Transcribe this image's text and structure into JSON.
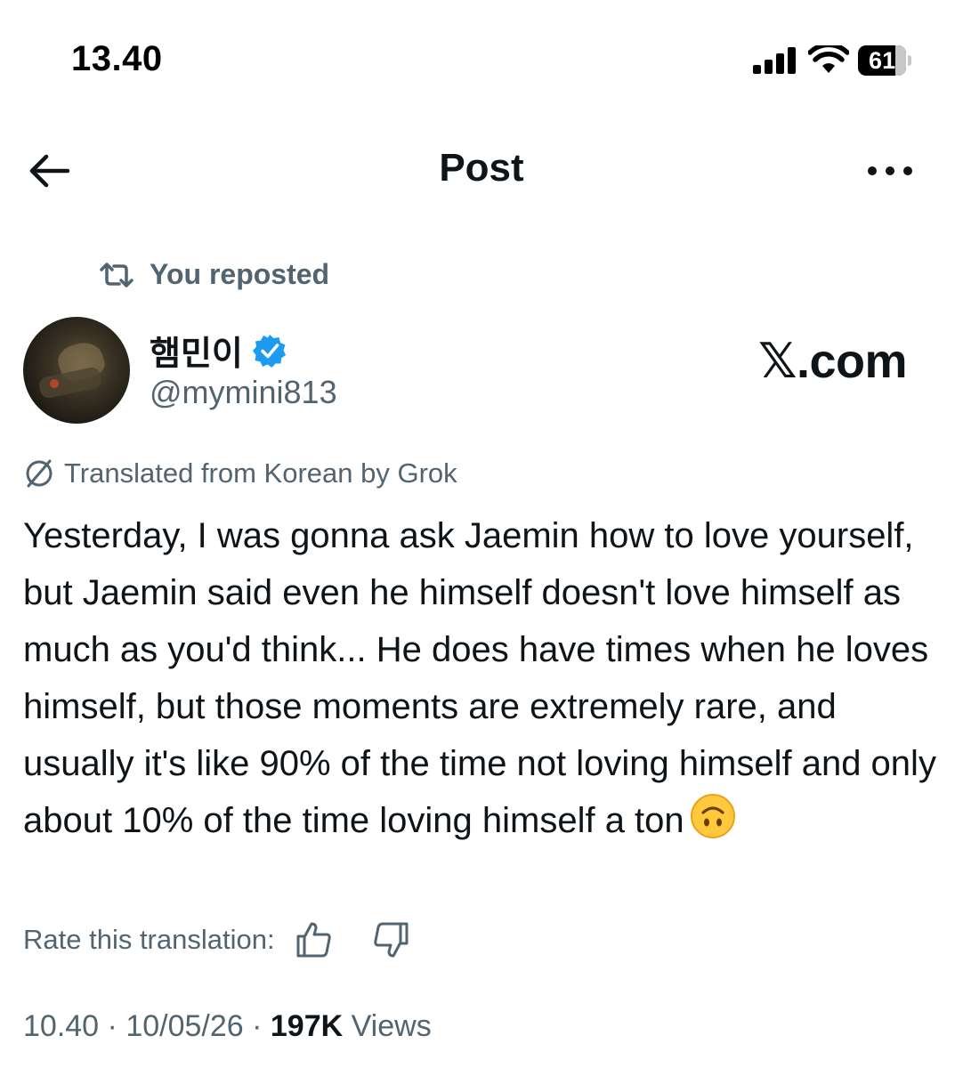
{
  "status_bar": {
    "time": "13.40",
    "battery_level": "61"
  },
  "header": {
    "title": "Post"
  },
  "repost": {
    "label": "You reposted"
  },
  "author": {
    "display_name": "햄민이",
    "handle": "@mymini813",
    "verified": true
  },
  "brand": {
    "label": "𝕏.com"
  },
  "translation": {
    "note": "Translated from Korean by Grok",
    "rate_label": "Rate this translation:"
  },
  "post": {
    "body": "Yesterday, I was gonna ask Jaemin how to love yourself, but Jaemin said even he himself doesn't love himself as much as you'd think... He does have times when he loves himself, but those moments are extremely rare, and usually it's like 90% of the time not loving himself and only about 10% of the time loving himself a ton"
  },
  "meta": {
    "time": "10.40",
    "separator1": " · ",
    "date": "10/05/26",
    "separator2": " · ",
    "views_count": "197K",
    "views_label": " Views"
  },
  "colors": {
    "text": "#0f1419",
    "secondary": "#536471",
    "verified": "#1d9bf0",
    "emoji": "#ffc83d"
  },
  "icons": {
    "back": "arrow-left-icon",
    "more": "more-horizontal-icon",
    "repost": "repost-icon",
    "verified": "verified-badge-icon",
    "grok": "grok-icon",
    "thumbs_up": "thumbs-up-icon",
    "thumbs_down": "thumbs-down-icon",
    "emoji": "upside-down-face-emoji"
  }
}
